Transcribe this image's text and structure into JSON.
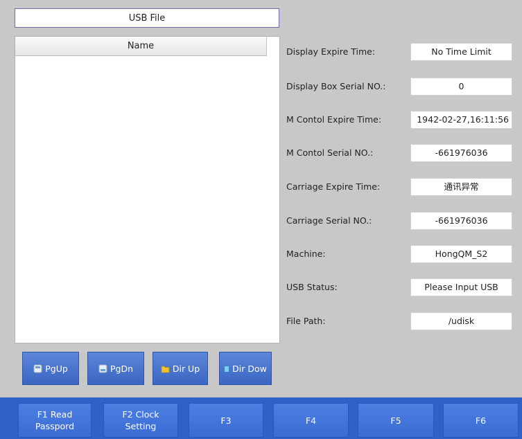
{
  "file_panel": {
    "title": "USB File",
    "column_name": "Name",
    "files": []
  },
  "nav_buttons": {
    "pgup": "PgUp",
    "pgdn": "PgDn",
    "dir_up": "Dir Up",
    "dir_down": "Dir Dow"
  },
  "info": {
    "display_expire_label": "Display Expire Time:",
    "display_expire_value": "No Time Limit",
    "display_serial_label": "Display Box Serial NO.:",
    "display_serial_value": "0",
    "m_control_expire_label": "M Contol Expire Time:",
    "m_control_expire_value": "1942-02-27,16:11:56",
    "m_control_serial_label": "M Contol Serial NO.:",
    "m_control_serial_value": "-661976036",
    "carriage_expire_label": "Carriage Expire Time:",
    "carriage_expire_value": "通讯异常",
    "carriage_serial_label": "Carriage Serial NO.:",
    "carriage_serial_value": "-661976036",
    "machine_label": "Machine:",
    "machine_value": "HongQM_S2",
    "usb_status_label": "USB Status:",
    "usb_status_value": "Please Input USB",
    "file_path_label": "File Path:",
    "file_path_value": "/udisk"
  },
  "function_keys": {
    "f1_line1": "F1 Read",
    "f1_line2": "Passpord",
    "f2_line1": "F2 Clock",
    "f2_line2": "Setting",
    "f3": "F3",
    "f4": "F4",
    "f5": "F5",
    "f6": "F6"
  },
  "colors": {
    "background": "#c8c8c8",
    "button_blue": "#3b66c2",
    "function_bar": "#2f62c6"
  }
}
